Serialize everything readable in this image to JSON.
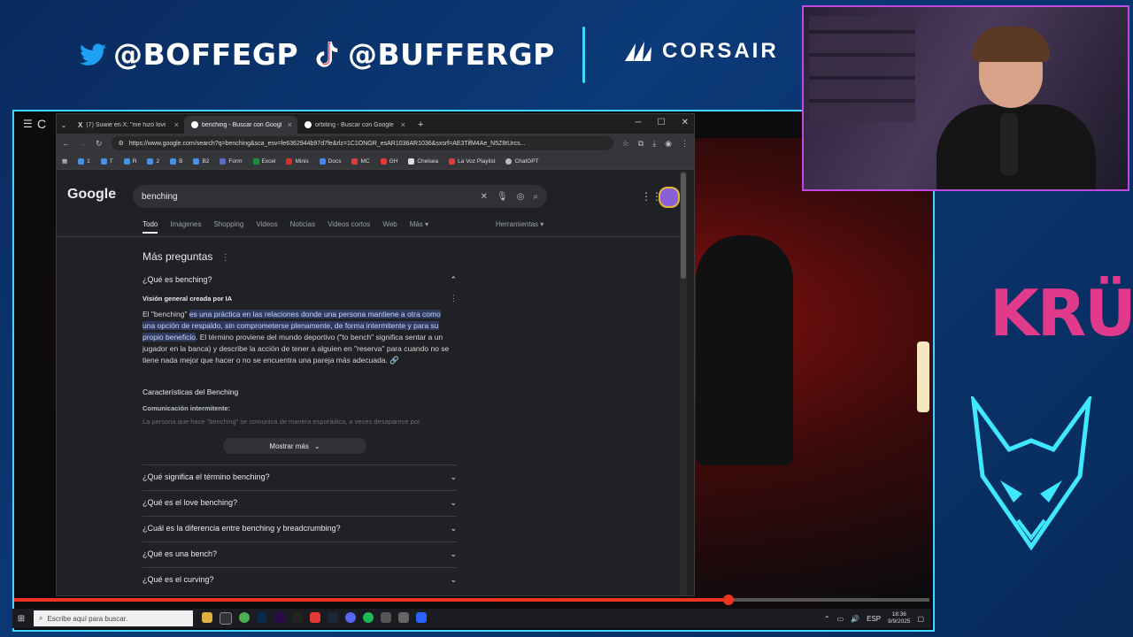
{
  "overlay": {
    "twitter_handle": "@BOFFEGP",
    "tiktok_handle": "@BUFFERGP",
    "sponsor": "CORSAIR",
    "team_logo_text": "KRÜ",
    "colors": {
      "accent": "#3fd6ff",
      "cam_border": "#c04adf",
      "kru": "#e23a8a"
    }
  },
  "stream": {
    "title_partial": "C"
  },
  "browser": {
    "tabs": [
      {
        "label": "(7) Suwie en X: \"me hizo lovebo",
        "icon": "x-icon"
      },
      {
        "label": "benching - Buscar con Google",
        "icon": "google-icon",
        "active": true
      },
      {
        "label": "orbiting - Buscar con Google",
        "icon": "google-icon"
      }
    ],
    "new_tab": "+",
    "url": "https://www.google.com/search?q=benching&sca_esv=fe6362944b97d7fe&rlz=1C1ONGR_esAR1036AR1036&sxsrf=AE3TifM4Ae_N5Z8tUrcs...",
    "bookmarks": [
      "1",
      "T",
      "R",
      "2",
      "B",
      "B2",
      "Form",
      "Excel",
      "Minis",
      "Docs",
      "MC",
      "GH",
      "Chelsea",
      "La Voz Playlist",
      "ChatGPT"
    ]
  },
  "google": {
    "logo": "Google",
    "query": "benching",
    "tabs": [
      "Todo",
      "Imágenes",
      "Shopping",
      "Videos",
      "Noticias",
      "Videos cortos",
      "Web",
      "Más ▾"
    ],
    "tools": "Herramientas ▾",
    "section_title": "Más preguntas",
    "open_question": "¿Qué es benching?",
    "ai_header": "Visión general creada por IA",
    "ai_text_pre": "El \"benching\" ",
    "ai_text_highlight": "es una práctica en las relaciones donde una persona mantiene a otra como una opción de respaldo, sin comprometerse plenamente, de forma intermitente y para su propio beneficio",
    "ai_text_post": ". El término proviene del mundo deportivo (\"to bench\" significa sentar a un jugador en la banca) y describe la acción de tener a alguien en \"reserva\" para cuando no se tiene nada mejor que hacer o no se encuentra una pareja más adecuada.",
    "subheading": "Características del Benching",
    "small_heading": "Comunicación intermitente:",
    "faded_text": "La persona que hace \"benching\" se comunica de manera esporádica, a veces desaparece por",
    "show_more": "Mostrar más",
    "questions": [
      "¿Qué significa el término benching?",
      "¿Qué es el love benching?",
      "¿Cuál es la diferencia entre benching y breadcrumbing?",
      "¿Qué es una bench?",
      "¿Qué es el curving?"
    ]
  },
  "video": {
    "progress": 0.78
  },
  "taskbar": {
    "search_placeholder": "Escribe aquí para buscar.",
    "lang": "ESP",
    "time": "18:36",
    "date": "9/9/2025"
  }
}
